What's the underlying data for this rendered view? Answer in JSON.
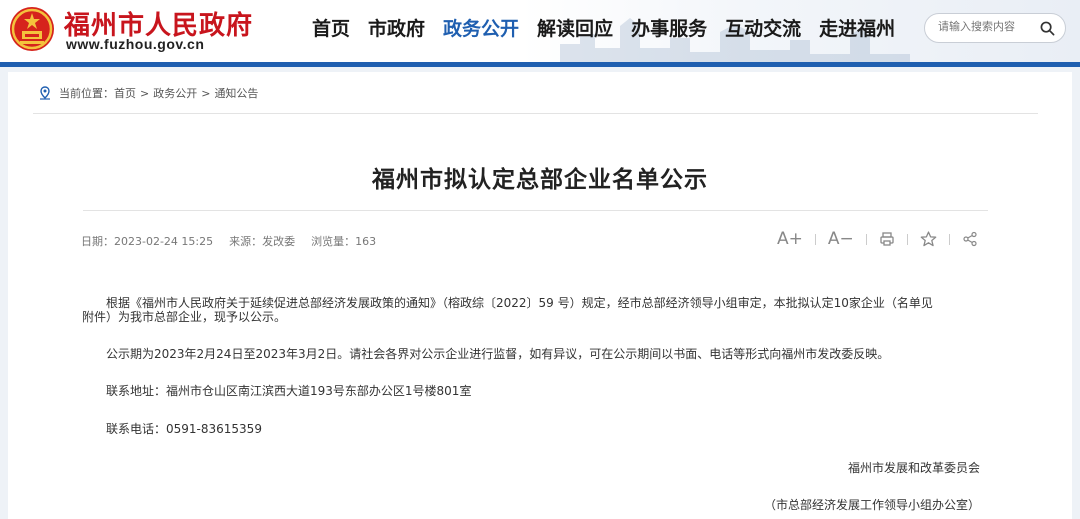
{
  "header": {
    "site_name": "福州市人民政府",
    "site_url": "www.fuzhou.gov.cn",
    "brand_color": "#c8151d",
    "accent_color": "#1f5fb0"
  },
  "nav": {
    "items": [
      {
        "label": "首页",
        "active": false
      },
      {
        "label": "市政府",
        "active": false
      },
      {
        "label": "政务公开",
        "active": true
      },
      {
        "label": "解读回应",
        "active": false
      },
      {
        "label": "办事服务",
        "active": false
      },
      {
        "label": "互动交流",
        "active": false
      },
      {
        "label": "走进福州",
        "active": false
      }
    ]
  },
  "search": {
    "placeholder": "请输入搜索内容",
    "icon": "search-icon"
  },
  "breadcrumb": {
    "prefix": "当前位置：",
    "items": [
      "首页",
      "政务公开",
      "通知公告"
    ],
    "separator": ">"
  },
  "article": {
    "title": "福州市拟认定总部企业名单公示",
    "meta": {
      "date": "日期：2023-02-24 15:25",
      "source": "来源：发改委",
      "views": "浏览量：163"
    },
    "tools": {
      "font_up": "A+",
      "font_down": "A−",
      "print_icon": "print-icon",
      "favorite_icon": "star-icon",
      "share_icon": "share-icon"
    },
    "paragraphs": {
      "p1_line1": "根据《福州市人民政府关于延续促进总部经济发展政策的通知》（榕政综〔2022〕59 号）规定，经市总部经济领导小组审定，本批拟认定10家企业（名单见",
      "p1_line2": "附件）为我市总部企业，现予以公示。",
      "p2": "公示期为2023年2月24日至2023年3月2日。请社会各界对公示企业进行监督，如有异议，可在公示期间以书面、电话等形式向福州市发改委反映。",
      "p3": "联系地址：福州市仓山区南江滨西大道193号东部办公区1号楼801室",
      "p4": "联系电话：0591-83615359"
    },
    "signature": {
      "org": "福州市发展和改革委员会",
      "office": "（市总部经济发展工作领导小组办公室）"
    }
  }
}
